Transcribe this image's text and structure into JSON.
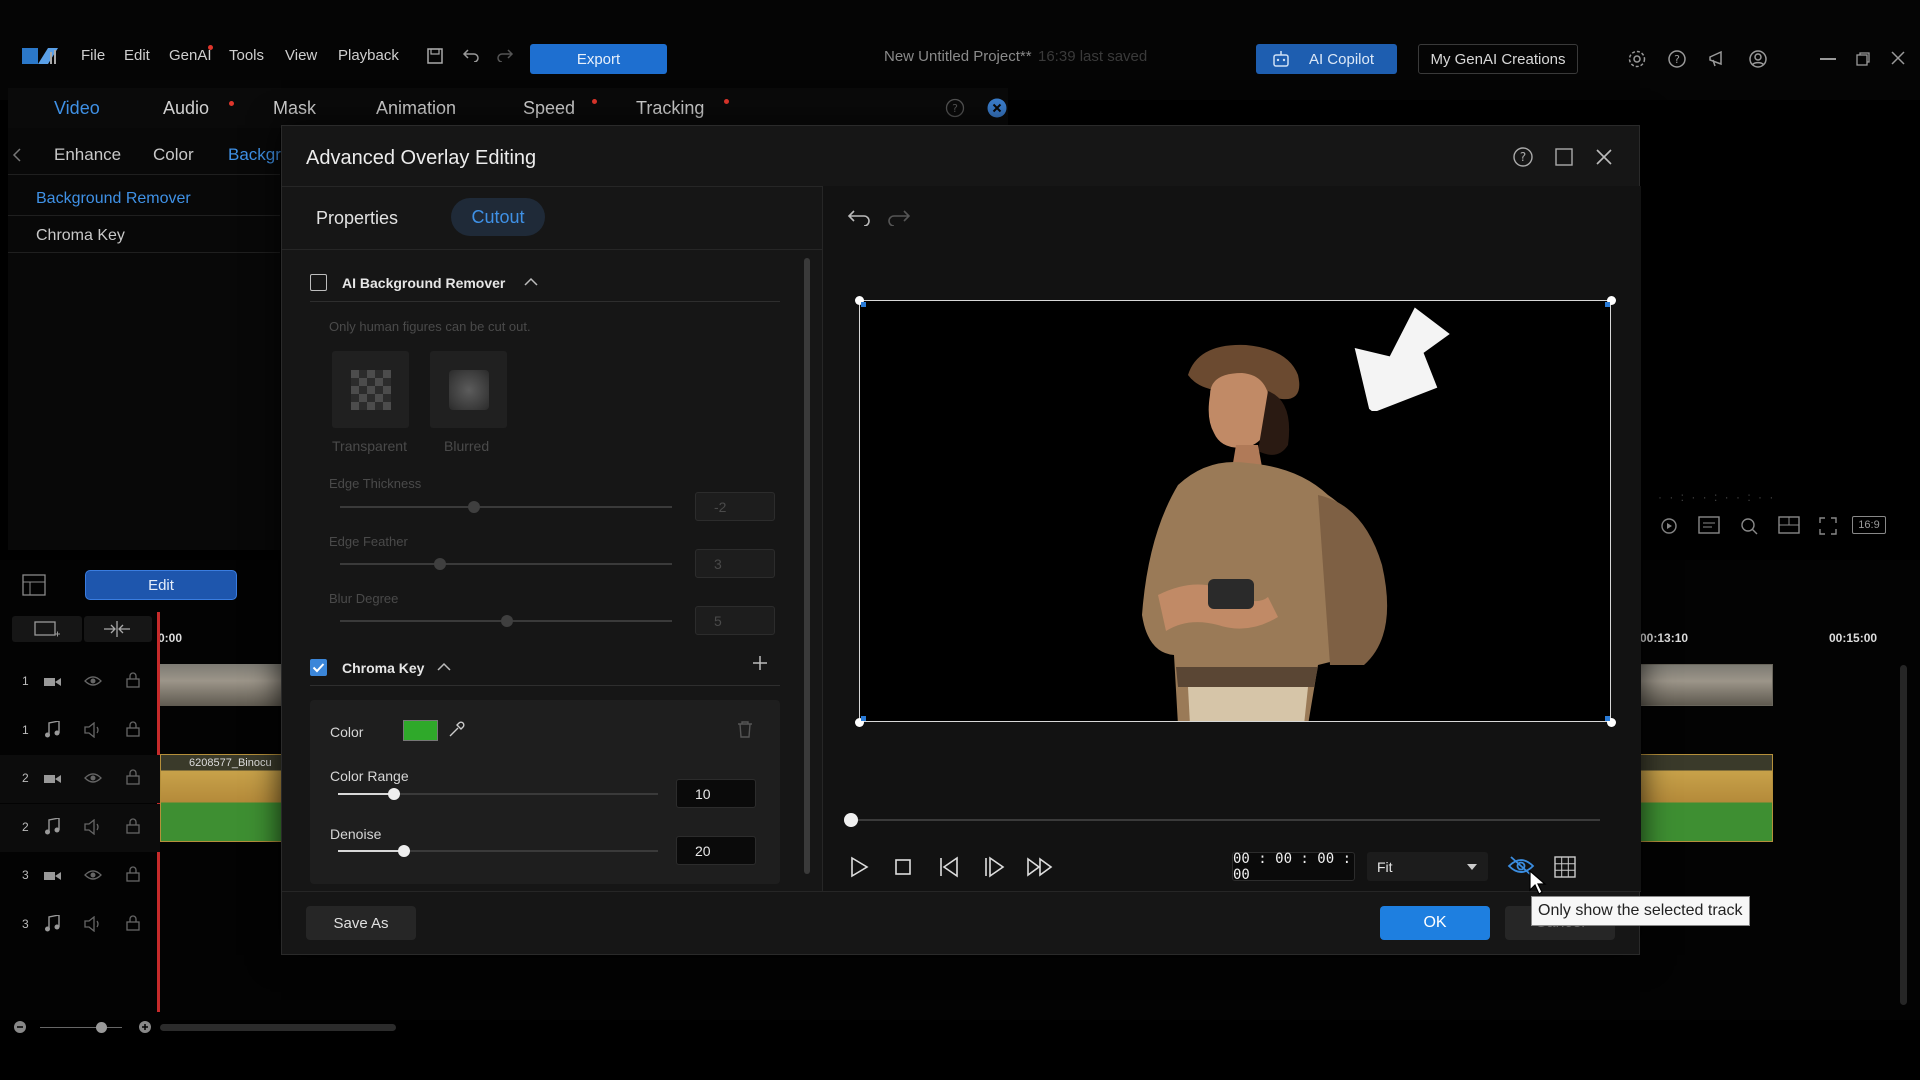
{
  "menubar": {
    "items": [
      "File",
      "Edit",
      "GenAI",
      "Tools",
      "View",
      "Playback"
    ],
    "export_label": "Export",
    "project_title": "New Untitled Project**",
    "last_saved": "16:39 last saved",
    "ai_copilot_label": "AI Copilot",
    "my_creations_label": "My GenAI Creations"
  },
  "left_panel": {
    "tabs": [
      "Video",
      "Audio",
      "Mask",
      "Animation",
      "Speed",
      "Tracking"
    ],
    "sub_tabs": [
      "Enhance",
      "Color",
      "Backgr"
    ],
    "items": [
      "Background Remover",
      "Chroma Key"
    ],
    "edit_label": "Edit"
  },
  "timeline": {
    "time_start": "0:00",
    "time_mid": "00:13:10",
    "time_end": "00:15:00",
    "clip_label_top": "6208577_Binocu",
    "track_numbers": [
      "1",
      "1",
      "2",
      "2",
      "3",
      "3"
    ],
    "aspect_label": "16:9"
  },
  "dialog": {
    "title": "Advanced Overlay Editing",
    "tabs": {
      "properties": "Properties",
      "cutout": "Cutout"
    },
    "ai_bg": {
      "title": "AI Background Remover",
      "hint": "Only human figures can be cut out.",
      "opt_transparent": "Transparent",
      "opt_blurred": "Blurred",
      "edge_thickness_label": "Edge Thickness",
      "edge_thickness_value": "-2",
      "edge_feather_label": "Edge Feather",
      "edge_feather_value": "3",
      "blur_degree_label": "Blur Degree",
      "blur_degree_value": "5"
    },
    "chroma": {
      "title": "Chroma Key",
      "color_label": "Color",
      "color_value": "#2fa92a",
      "color_range_label": "Color Range",
      "color_range_value": "10",
      "denoise_label": "Denoise",
      "denoise_value": "20"
    },
    "player": {
      "timecode": "00 : 00 : 00 : 00",
      "zoom": "Fit",
      "tooltip": "Only show the selected track"
    },
    "save_as_label": "Save As",
    "ok_label": "OK",
    "cancel_label": "Cancel"
  },
  "colors": {
    "accent": "#1e7fe0",
    "active_tab": "#3b8de0"
  }
}
